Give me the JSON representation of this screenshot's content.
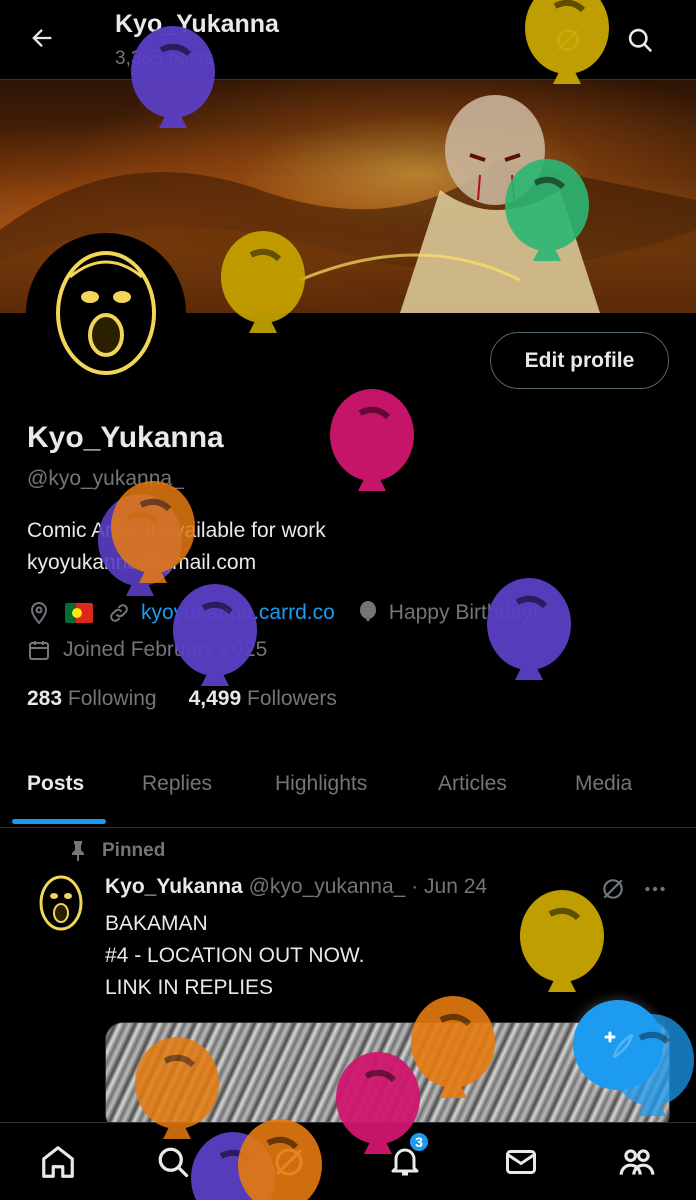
{
  "header": {
    "title": "Kyo_Yukanna",
    "posts_count": "3,385 posts",
    "back_icon": "back-arrow-icon",
    "grok_icon": "grok-icon",
    "search_icon": "search-icon"
  },
  "profile": {
    "edit_label": "Edit profile",
    "display_name": "Kyo_Yukanna",
    "handle": "@kyo_yukanna_",
    "bio_line1": "Comic Artist || Available for work",
    "bio_line2": "kyoyukanna@gmail.com",
    "link": "kyoyukanna.carrd.co",
    "birthday": "Happy Birthday!",
    "joined": "Joined February 2025",
    "following_count": "283",
    "following_label": "Following",
    "followers_count": "4,499",
    "followers_label": "Followers",
    "location_flag": "Portugal flag"
  },
  "tabs": [
    {
      "label": "Posts",
      "active": true
    },
    {
      "label": "Replies"
    },
    {
      "label": "Highlights"
    },
    {
      "label": "Articles"
    },
    {
      "label": "Media"
    }
  ],
  "post": {
    "pinned_label": "Pinned",
    "author": "Kyo_Yukanna",
    "handle": "@kyo_yukanna_",
    "date": "· Jun 24",
    "line1": "BAKAMAN",
    "line2": "#4 - LOCATION OUT NOW.",
    "line3": "LINK IN REPLIES"
  },
  "nav": {
    "notifications_badge": "3",
    "items": [
      "home-icon",
      "search-icon",
      "grok-icon",
      "notifications-icon",
      "messages-icon",
      "communities-icon"
    ]
  },
  "colors": {
    "accent": "#1d9bf0",
    "muted": "#71767b",
    "balloons": [
      "#5b3fc4",
      "#c9a700",
      "#2bb673",
      "#d0176f",
      "#e67b10"
    ]
  }
}
